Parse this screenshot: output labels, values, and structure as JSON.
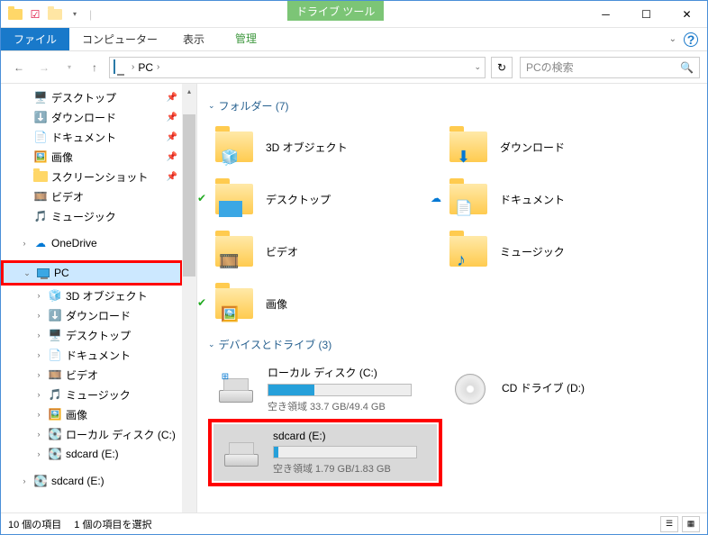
{
  "window": {
    "title": "PC",
    "tool_tab": "ドライブ ツール"
  },
  "ribbon": {
    "file": "ファイル",
    "computer": "コンピューター",
    "view": "表示",
    "manage": "管理"
  },
  "nav": {
    "location": "PC",
    "search_placeholder": "PCの検索"
  },
  "tree": {
    "items": [
      {
        "label": "デスクトップ",
        "icon": "desktop",
        "pin": true,
        "lvl": 2
      },
      {
        "label": "ダウンロード",
        "icon": "download",
        "pin": true,
        "lvl": 2
      },
      {
        "label": "ドキュメント",
        "icon": "document",
        "pin": true,
        "lvl": 2
      },
      {
        "label": "画像",
        "icon": "pictures",
        "pin": true,
        "lvl": 2
      },
      {
        "label": "スクリーンショット",
        "icon": "folder",
        "pin": true,
        "lvl": 2
      },
      {
        "label": "ビデオ",
        "icon": "video",
        "pin": false,
        "lvl": 2
      },
      {
        "label": "ミュージック",
        "icon": "music",
        "pin": false,
        "lvl": 2
      }
    ],
    "onedrive": "OneDrive",
    "pc": "PC",
    "pc_children": [
      {
        "label": "3D オブジェクト",
        "icon": "3d"
      },
      {
        "label": "ダウンロード",
        "icon": "download"
      },
      {
        "label": "デスクトップ",
        "icon": "desktop"
      },
      {
        "label": "ドキュメント",
        "icon": "document"
      },
      {
        "label": "ビデオ",
        "icon": "video"
      },
      {
        "label": "ミュージック",
        "icon": "music"
      },
      {
        "label": "画像",
        "icon": "pictures"
      },
      {
        "label": "ローカル ディスク (C:)",
        "icon": "drive"
      },
      {
        "label": "sdcard (E:)",
        "icon": "drive"
      }
    ],
    "sdcard_ext": "sdcard (E:)"
  },
  "content": {
    "group_folders": "フォルダー (7)",
    "group_drives": "デバイスとドライブ (3)",
    "folders": [
      {
        "label": "3D オブジェクト",
        "badge": ""
      },
      {
        "label": "ダウンロード",
        "badge": ""
      },
      {
        "label": "デスクトップ",
        "badge": "sync"
      },
      {
        "label": "ドキュメント",
        "badge": "cloud"
      },
      {
        "label": "ビデオ",
        "badge": ""
      },
      {
        "label": "ミュージック",
        "badge": ""
      },
      {
        "label": "画像",
        "badge": "sync"
      }
    ],
    "drives": [
      {
        "name": "ローカル ディスク (C:)",
        "space": "空き領域 33.7 GB/49.4 GB",
        "fill_pct": 32
      },
      {
        "name": "sdcard (E:)",
        "space": "空き領域 1.79 GB/1.83 GB",
        "fill_pct": 3,
        "selected": true,
        "highlight": true
      },
      {
        "name": "CD ドライブ (D:)",
        "space": "",
        "fill_pct": -1
      }
    ]
  },
  "status": {
    "count": "10 個の項目",
    "selected": "1 個の項目を選択"
  }
}
